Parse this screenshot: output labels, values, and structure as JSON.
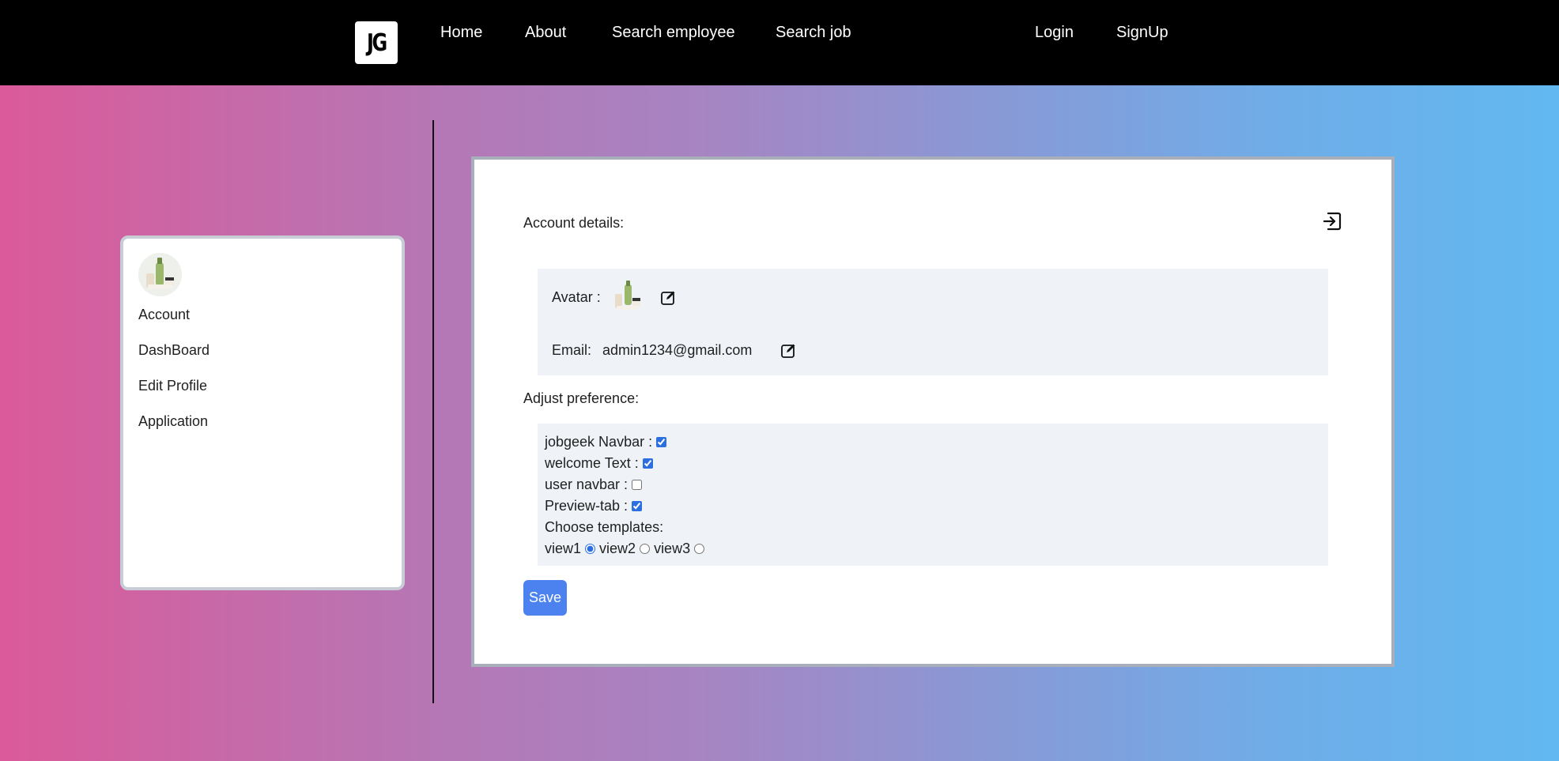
{
  "navbar": {
    "logo_text": "JG",
    "links": {
      "home": "Home",
      "about": "About",
      "search_employee": "Search employee",
      "search_job": "Search job",
      "login": "Login",
      "signup": "SignUp"
    }
  },
  "sidebar": {
    "avatar_icon": "product-bottles-avatar",
    "items": [
      "Account",
      "DashBoard",
      "Edit Profile",
      "Application"
    ]
  },
  "account": {
    "title": "Account details:",
    "logout_icon": "logout-icon",
    "avatar_label": "Avatar :",
    "email_label": "Email:",
    "email_value": "admin1234@gmail.com",
    "edit_icon": "edit-icon"
  },
  "preferences": {
    "title": "Adjust preference:",
    "options": [
      {
        "label": "jobgeek Navbar :",
        "checked": true
      },
      {
        "label": "welcome Text :",
        "checked": true
      },
      {
        "label": "user navbar :",
        "checked": false
      },
      {
        "label": "Preview-tab :",
        "checked": true
      }
    ],
    "templates_label": "Choose templates:",
    "templates": [
      {
        "label": "view1",
        "selected": true
      },
      {
        "label": "view2",
        "selected": false
      },
      {
        "label": "view3",
        "selected": false
      }
    ],
    "save_label": "Save"
  },
  "colors": {
    "navbar_bg": "#000000",
    "accent": "#4c82ef",
    "gradient_left": "#db5a9a",
    "gradient_right": "#62b8f0",
    "panel_bg": "#eff3f8"
  }
}
